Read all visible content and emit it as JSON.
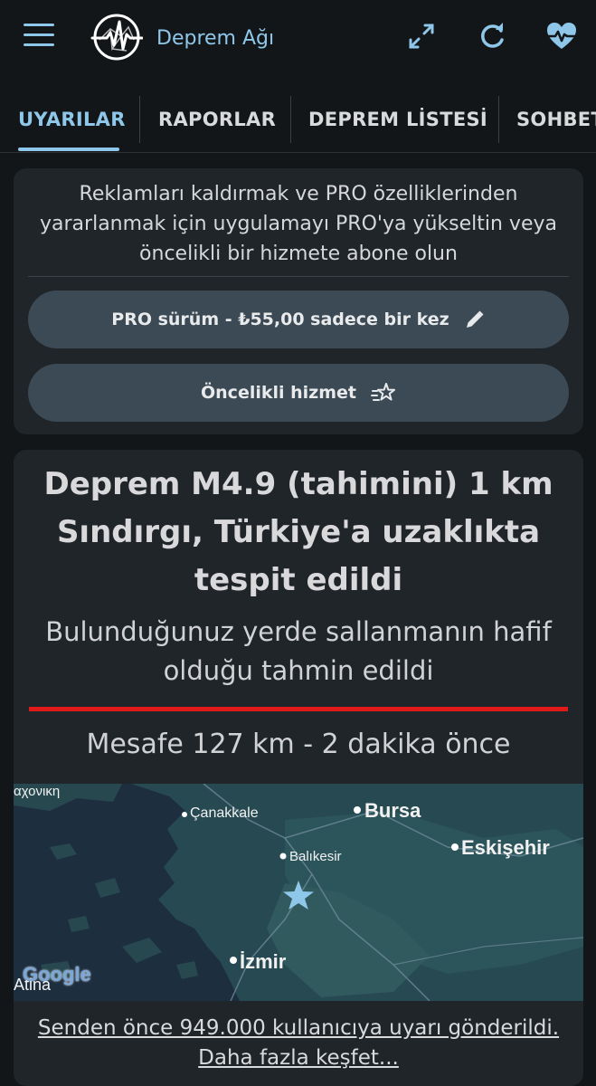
{
  "app": {
    "title": "Deprem Ağı",
    "accent_color": "#8fc7ea",
    "icons": [
      "hamburger-menu-icon",
      "expand-icon",
      "refresh-icon",
      "heart-pulse-icon"
    ]
  },
  "tabs": [
    {
      "label": "UYARILAR",
      "active": true
    },
    {
      "label": "RAPORLAR",
      "active": false
    },
    {
      "label": "DEPREM LİSTESİ",
      "active": false
    },
    {
      "label": "SOHBET",
      "active": false
    }
  ],
  "promo": {
    "text": "Reklamları kaldırmak ve PRO özelliklerinden yararlanmak için uygulamayı PRO'ya yükseltin veya öncelikli bir hizmete abone olun",
    "pro_button": "PRO sürüm - ₺55,00 sadece bir kez",
    "priority_button": "Öncelikli hizmet",
    "pro_icon": "pencil-icon",
    "priority_icon": "sparkle-star-icon"
  },
  "quake": {
    "title": "Deprem M4.9 (tahimini) 1 km Sındırgı, Türkiye'a uzaklıkta tespit edildi",
    "subtitle": "Bulunduğunuz yerde sallanmanın hafif olduğu tahmin edildi",
    "distance": "Mesafe 127 km - 2 dakika önce",
    "alert_color": "#e01919",
    "footer": "Senden önce 949.000 kullanıcıya uyarı gönderildi. Daha fazla keşfet..."
  },
  "map": {
    "labels": {
      "greek": "αχονικη",
      "canakkale": "Çanakkale",
      "bursa": "Bursa",
      "balikesir": "Balıkesir",
      "eskisehir": "Eskişehir",
      "izmir": "İzmir",
      "atina": "Atina",
      "google": "Google"
    },
    "marker_icon": "epicenter-star-icon"
  }
}
